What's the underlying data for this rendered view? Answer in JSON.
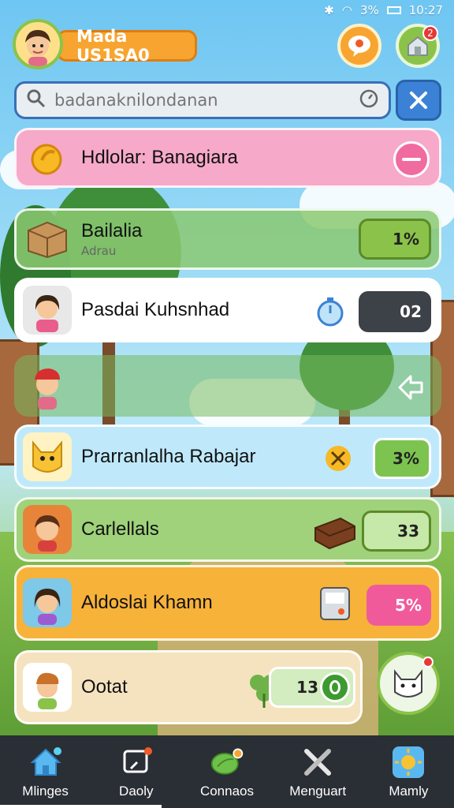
{
  "status_bar": {
    "battery": "3%",
    "time": "10:27"
  },
  "profile": {
    "name": "Mada US1SA0"
  },
  "header": {
    "pet_notification_count": "2"
  },
  "search": {
    "placeholder": "badanaknilondanan"
  },
  "items": [
    {
      "name": "Hdlolar: Banagiara",
      "subtitle": "",
      "badge": ""
    },
    {
      "name": "Bailalia",
      "subtitle": "Adrau",
      "badge": "1%"
    },
    {
      "name": "Pasdai Kuhsnhad",
      "subtitle": "",
      "badge": "02"
    },
    {
      "name": "",
      "subtitle": "",
      "badge": ""
    },
    {
      "name": "Prarranlalha Rabajar",
      "subtitle": "",
      "badge": "3%"
    },
    {
      "name": "Carlellals",
      "subtitle": "",
      "badge": "33"
    },
    {
      "name": "Aldoslai Khamn",
      "subtitle": "",
      "badge": "5%"
    },
    {
      "name": "Ootat",
      "subtitle": "",
      "badge": "13"
    }
  ],
  "nav": [
    {
      "label": "Mlinges"
    },
    {
      "label": "Daoly"
    },
    {
      "label": "Connaos"
    },
    {
      "label": "Menguart"
    },
    {
      "label": "Mamly"
    }
  ],
  "colors": {
    "accent_orange": "#f7a530",
    "accent_blue": "#3b82d6",
    "nav_bg": "#2a2e35"
  }
}
